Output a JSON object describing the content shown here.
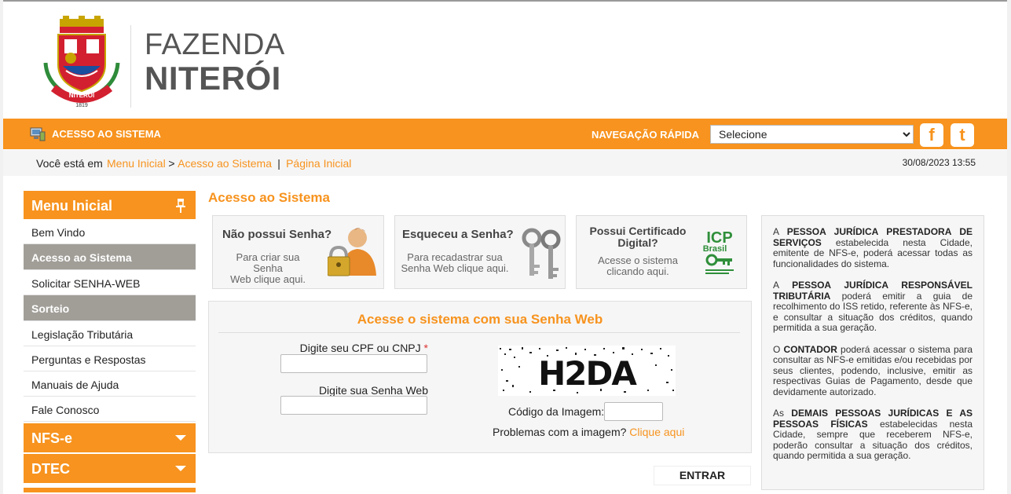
{
  "header": {
    "logo_line1": "FAZENDA",
    "logo_line2": "NITERÓI",
    "crest_text": "NITERÓI",
    "crest_year": "1819"
  },
  "topbar": {
    "system_label": "ACESSO AO SISTEMA",
    "quick_nav_label": "NAVEGAÇÃO RÁPIDA",
    "quick_nav_selected": "Selecione",
    "facebook_icon": "f",
    "twitter_icon": "t"
  },
  "breadcrumb": {
    "prefix": "Você está em",
    "items": [
      "Menu Inicial",
      "Acesso ao Sistema"
    ],
    "separator": ">",
    "divider": "|",
    "home": "Página Inicial",
    "datetime": "30/08/2023 13:55"
  },
  "sidebar": {
    "title": "Menu Inicial",
    "items": [
      {
        "label": "Bem Vindo",
        "active": false
      },
      {
        "label": "Acesso ao Sistema",
        "active": true
      },
      {
        "label": "Solicitar SENHA-WEB",
        "active": false
      },
      {
        "label": "Sorteio",
        "active": true
      },
      {
        "label": "Legislação Tributária",
        "active": false
      },
      {
        "label": "Perguntas e Respostas",
        "active": false
      },
      {
        "label": "Manuais de Ajuda",
        "active": false
      },
      {
        "label": "Fale Conosco",
        "active": false
      }
    ],
    "sections": [
      "NFS-e",
      "DTEC"
    ]
  },
  "main": {
    "title": "Acesso ao Sistema",
    "cards": [
      {
        "title": "Não possui Senha?",
        "sub_line1": "Para criar sua Senha",
        "sub_line2": "Web clique aqui."
      },
      {
        "title": "Esqueceu a Senha?",
        "sub_line1": "Para recadastrar sua",
        "sub_line2": "Senha Web clique aqui."
      },
      {
        "title_line1": "Possui Certificado",
        "title_line2": "Digital?",
        "sub_line1": "Acesse o sistema",
        "sub_line2": "clicando aqui."
      }
    ],
    "icp_logo": {
      "line1": "ICP",
      "line2": "Brasil"
    }
  },
  "login": {
    "title": "Acesse o sistema com sua Senha Web",
    "cpf_label": "Digite seu CPF ou CNPJ",
    "required_mark": "*",
    "cpf_value": "",
    "password_label": "Digite sua Senha Web",
    "password_value": "",
    "captcha_text": "H2DA",
    "code_label": "Código da Imagem:",
    "code_value": "",
    "problems_text": "Problemas com a imagem?",
    "problems_link": "Clique aqui",
    "submit_label": "ENTRAR"
  },
  "info": {
    "paragraphs": [
      {
        "pre": "A ",
        "bold": "PESSOA JURÍDICA PRESTADORA DE SERVIÇOS",
        "post": " estabelecida nesta Cidade, emitente de NFS-e, poderá acessar todas as funcionalidades do sistema."
      },
      {
        "pre": "A ",
        "bold": "PESSOA JURÍDICA RESPONSÁVEL TRIBUTÁRIA",
        "post": " poderá emitir a guia de recolhimento do ISS retido, referente às NFS-e, e consultar a situação dos créditos, quando permitida a sua geração."
      },
      {
        "pre": "O ",
        "bold": "CONTADOR",
        "post": " poderá acessar o sistema para consultar as NFS-e emitidas e/ou recebidas por seus clientes, podendo, inclusive, emitir as respectivas Guias de Pagamento, desde que devidamente autorizado."
      },
      {
        "pre": "As ",
        "bold": "DEMAIS PESSOAS JURÍDICAS E AS PESSOAS FÍSICAS",
        "post": " estabelecidas nesta Cidade, sempre que receberem NFS-e, poderão consultar a situação dos créditos, quando permitida a sua geração."
      }
    ]
  },
  "colors": {
    "accent": "#f7931e",
    "active_menu": "#a19e98",
    "panel_bg": "#f6f6f6"
  }
}
